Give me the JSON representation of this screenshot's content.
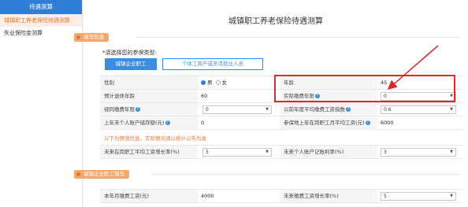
{
  "sidebar": {
    "header": "待遇测算",
    "items": [
      {
        "label": "城镇职工养老保险待遇测算",
        "active": true
      },
      {
        "label": "失业保险金测算",
        "active": false
      }
    ]
  },
  "title": "城镇职工养老保险待遇测算",
  "sections": {
    "fill_info": "填写信息",
    "company_pay": "城镇企业职工填写"
  },
  "prompt": "*请选择您的参保类型:",
  "insured_type": {
    "primary": "城镇企业职工",
    "secondary": "个体工商户或灵活就业人员"
  },
  "form": {
    "gender_label": "性别",
    "gender_male": "男",
    "gender_female": "女",
    "age_label": "年龄",
    "age_value": "45",
    "retire_age_label": "预计退休年龄",
    "retire_age_value": "60",
    "actual_years_label": "实际缴费年限",
    "actual_years_value": "0",
    "deemed_years_label": "视同缴费年限",
    "deemed_years_value": "0",
    "avg_index_label": "以前年度平均缴费工资指数",
    "avg_index_value": "0.6",
    "account_label": "上年末个人账户储存额(元)",
    "account_value": "0",
    "avg_wage_label": "参保地上年在岗职工月平均工资(元)",
    "avg_wage_value": "6000"
  },
  "note": "以下为预测信息，实际情况请以统计公布为准",
  "forecast": {
    "wage_growth_label": "未来在岗职工平均工资增长率(%)",
    "wage_growth_value": "5",
    "interest_label": "未来个人账户记账利率(%)",
    "interest_value": "3"
  },
  "company": {
    "monthly_wage_label": "本年月缴费工资(元)",
    "monthly_wage_value": "4000",
    "future_growth_label": "未来缴费工资增长率(%)",
    "future_growth_value": "5"
  },
  "colors": {
    "accent": "#2f7fd8",
    "orange": "#e8742a",
    "highlight": "#d92b2b"
  }
}
